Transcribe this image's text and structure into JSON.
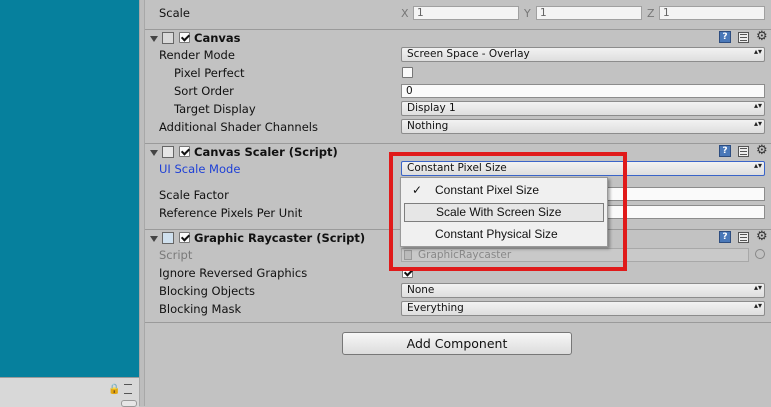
{
  "transform": {
    "scale_label": "Scale",
    "x_label": "X",
    "x_value": "1",
    "y_label": "Y",
    "y_value": "1",
    "z_label": "Z",
    "z_value": "1"
  },
  "canvas": {
    "title": "Canvas",
    "render_mode_label": "Render Mode",
    "render_mode_value": "Screen Space - Overlay",
    "pixel_perfect_label": "Pixel Perfect",
    "sort_order_label": "Sort Order",
    "sort_order_value": "0",
    "target_display_label": "Target Display",
    "target_display_value": "Display 1",
    "shader_channels_label": "Additional Shader Channels",
    "shader_channels_value": "Nothing"
  },
  "canvas_scaler": {
    "title": "Canvas Scaler (Script)",
    "ui_scale_mode_label": "UI Scale Mode",
    "ui_scale_mode_value": "Constant Pixel Size",
    "scale_factor_label": "Scale Factor",
    "ref_ppu_label": "Reference Pixels Per Unit"
  },
  "scale_mode_popup": {
    "items": [
      {
        "label": "Constant Pixel Size",
        "checked": true
      },
      {
        "label": "Scale With Screen Size",
        "checked": false
      },
      {
        "label": "Constant Physical Size",
        "checked": false
      }
    ],
    "check_glyph": "✓"
  },
  "graphic_raycaster": {
    "title": "Graphic Raycaster (Script)",
    "script_label": "Script",
    "script_value": "GraphicRaycaster",
    "ignore_reversed_label": "Ignore Reversed Graphics",
    "blocking_objects_label": "Blocking Objects",
    "blocking_objects_value": "None",
    "blocking_mask_label": "Blocking Mask",
    "blocking_mask_value": "Everything"
  },
  "add_component_label": "Add Component",
  "icons": {
    "help": "?",
    "gear": "⚙",
    "dropdown_arrow": "▴▾"
  },
  "colors": {
    "scene_view": "#06809d",
    "highlight": "#e01a1a",
    "blue_label": "#1d3fd6"
  }
}
